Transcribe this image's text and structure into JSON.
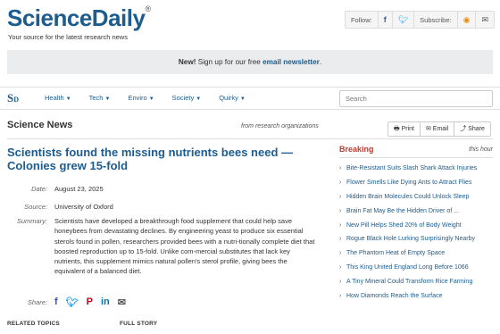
{
  "header": {
    "logo": "ScienceDaily",
    "logo_mark": "®",
    "tagline": "Your source for the latest research news",
    "follow_label": "Follow:",
    "subscribe_label": "Subscribe:"
  },
  "banner": {
    "new_label": "New!",
    "text": " Sign up for our free ",
    "link": "email newsletter",
    "end": "."
  },
  "nav": {
    "logo": "S",
    "logo_small": "D",
    "items": [
      {
        "label": "Health"
      },
      {
        "label": "Tech"
      },
      {
        "label": "Enviro"
      },
      {
        "label": "Society"
      },
      {
        "label": "Quirky"
      }
    ],
    "search_placeholder": "Search"
  },
  "section": {
    "title": "Science News",
    "from": "from research organizations",
    "tools": [
      "Print",
      "Email",
      "Share"
    ]
  },
  "article": {
    "headline": "Scientists found the missing nutrients bees need — Colonies grew 15-fold",
    "date_label": "Date:",
    "date": "August 23, 2025",
    "source_label": "Source:",
    "source": "University of Oxford",
    "summary_label": "Summary:",
    "summary": "Scientists have developed a breakthrough food supplement that could help save honeybees from devastating declines. By engineering yeast to produce six essential sterols found in pollen, researchers provided bees with a nutri-tionally complete diet that boosted reproduction up to 15-fold. Unlike com-mercial substitutes that lack key nutrients, this supplement mimics natural pollen's sterol profile, giving bees the equivalent of a balanced diet.",
    "share_label": "Share:",
    "related_topics": "RELATED TOPICS",
    "full_story": "FULL STORY"
  },
  "breaking": {
    "title": "Breaking",
    "subtitle": "this hour",
    "items": [
      "Bite-Resistant Suits Slash Shark Attack Injuries",
      "Flower Smells Like Dying Ants to Attract Flies",
      "Hidden Brain Molecules Could Unlock Sleep",
      "Brain Fat May Be the Hidden Driver of ...",
      "New Pill Helps Shed 20% of Body Weight",
      "Rogue Black Hole Lurking Surprisingly Nearby",
      "The Phantom Heat of Empty Space",
      "This King United England Long Before 1066",
      "A Tiny Mineral Could Transform Rice Farming",
      "How Diamonds Reach the Surface"
    ]
  },
  "colors": {
    "brand_blue": "#1d5c8e",
    "breaking_red": "#c0392b",
    "banner_bg": "#eaecee"
  }
}
